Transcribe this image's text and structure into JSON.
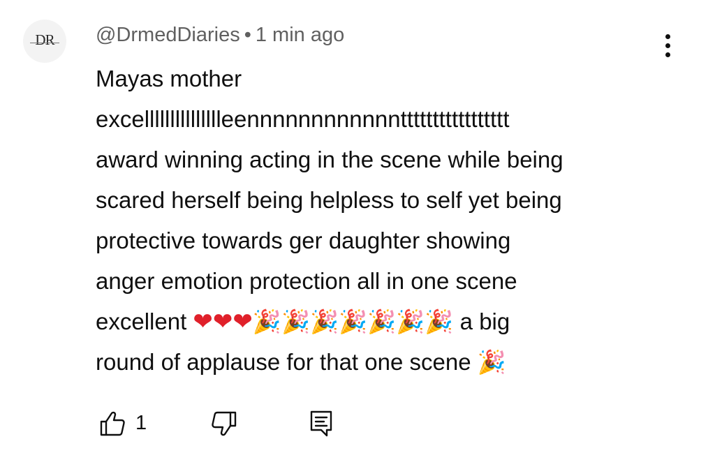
{
  "comment": {
    "avatar_text": "DR",
    "author": "@DrmedDiaries",
    "separator": "•",
    "timestamp": "1 min ago",
    "text": "Mayas mother excellllllllllllllleennnnnnnnnnnnttttttttttttttttt award winning acting in the scene while being scared herself being helpless to self yet being protective towards ger daughter showing anger emotion protection all in one scene excellent ❤️❤️❤️🎉🎉🎉🎉🎉🎉🎉 a big round of applause for that one scene 🎉",
    "lines": [
      "Mayas mother",
      "excellllllllllllllleennnnnnnnnnnnttttttttttttttttt",
      "award winning acting in the scene while being",
      "scared herself being helpless to self yet being",
      "protective towards ger daughter showing",
      "anger emotion protection all in one scene"
    ],
    "line7_text_before": "excellent ",
    "line7_hearts": "❤❤❤",
    "line7_party": "🎉🎉🎉🎉🎉🎉🎉",
    "line7_text_after": " a big",
    "line8_text": "round of applause for that one scene ",
    "line8_party": "🎉"
  },
  "actions": {
    "like_count": "1",
    "like_icon": "thumbs-up-icon",
    "dislike_icon": "thumbs-down-icon",
    "reply_icon": "reply-comment-icon",
    "more_icon": "more-vertical-icon"
  },
  "colors": {
    "meta_text": "#606060",
    "body_text": "#0f0f0f",
    "heart": "#e0202a"
  }
}
